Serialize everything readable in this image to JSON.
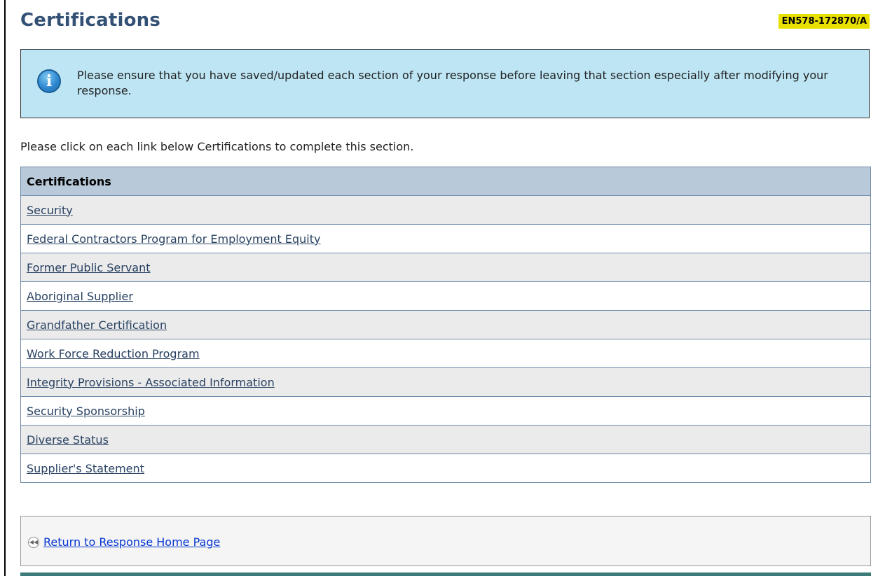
{
  "header": {
    "title": "Certifications",
    "reference": "EN578-172870/A"
  },
  "info": {
    "text": "Please ensure that you have saved/updated each section of your response before leaving that section especially after modifying your response."
  },
  "instruction": "Please click on each link below Certifications to complete this section.",
  "table": {
    "header": "Certifications",
    "rows": [
      "Security",
      "Federal Contractors Program for Employment Equity",
      "Former Public Servant",
      "Aboriginal Supplier",
      "Grandfather Certification",
      "Work Force Reduction Program",
      "Integrity Provisions - Associated Information",
      "Security Sponsorship",
      "Diverse Status",
      "Supplier's Statement"
    ]
  },
  "footer": {
    "return_label": "Return to Response Home Page"
  },
  "icons": {
    "info": "info-icon",
    "rewind": "rewind-icon"
  },
  "colors": {
    "title": "#335075",
    "badge": "#e8e000",
    "info_box": "#bde5f4",
    "table_header": "#b8cad9",
    "link": "#284162",
    "return_link": "#0535d2"
  }
}
